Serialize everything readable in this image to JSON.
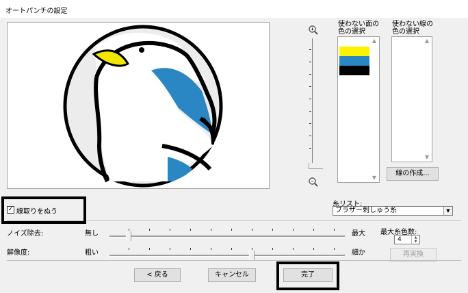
{
  "window": {
    "title": "オートパンチの設定"
  },
  "preview": {
    "image": "penguin-illustration"
  },
  "zoom": {
    "in_icon": "zoom-in-icon",
    "out_icon": "zoom-out-icon"
  },
  "unused_face_colors": {
    "label_line1": "使わない面の",
    "label_line2": "色の選択",
    "colors": [
      "#fff200",
      "#2b86c4",
      "#000000"
    ]
  },
  "unused_line_colors": {
    "label_line1": "使わない線の",
    "label_line2": "色の選択",
    "colors": []
  },
  "buttons": {
    "create_line": "線の作成...",
    "back": "< 戻る",
    "cancel": "キャンセル",
    "finish": "完了",
    "redo": "再実換"
  },
  "outline_checkbox": {
    "label": "線取りをぬう",
    "checked": true
  },
  "thread_list": {
    "label": "糸リスト:",
    "value": "ブラザー刺しゅう糸"
  },
  "noise": {
    "label": "ノイズ除去:",
    "min_label": "無し",
    "max_label": "最大",
    "level": 0.0
  },
  "resolution": {
    "label": "解像度:",
    "min_label": "粗い",
    "max_label": "細か",
    "level": 0.6
  },
  "max_colors": {
    "label": "最大糸色数:",
    "value": "4"
  },
  "accent": {
    "highlight": "#000000"
  }
}
